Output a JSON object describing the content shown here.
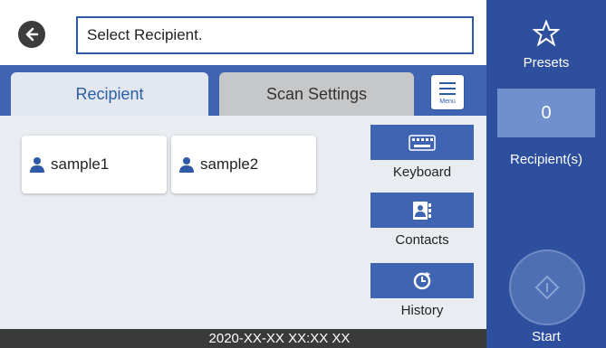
{
  "header": {
    "field_text": "Select Recipient."
  },
  "tabs": {
    "recipient": "Recipient",
    "scan_settings": "Scan Settings",
    "menu_label": "Menu"
  },
  "recipients": [
    {
      "name": "sample1"
    },
    {
      "name": "sample2"
    }
  ],
  "actions": {
    "keyboard": "Keyboard",
    "contacts": "Contacts",
    "history": "History"
  },
  "right_panel": {
    "presets": "Presets",
    "count": "0",
    "recipients_label": "Recipient(s)",
    "start": "Start"
  },
  "status": {
    "datetime": "2020-XX-XX XX:XX XX"
  },
  "colors": {
    "accent_blue": "#3f64b1",
    "panel_blue": "#2d4f9e",
    "field_border": "#2d59a7"
  }
}
